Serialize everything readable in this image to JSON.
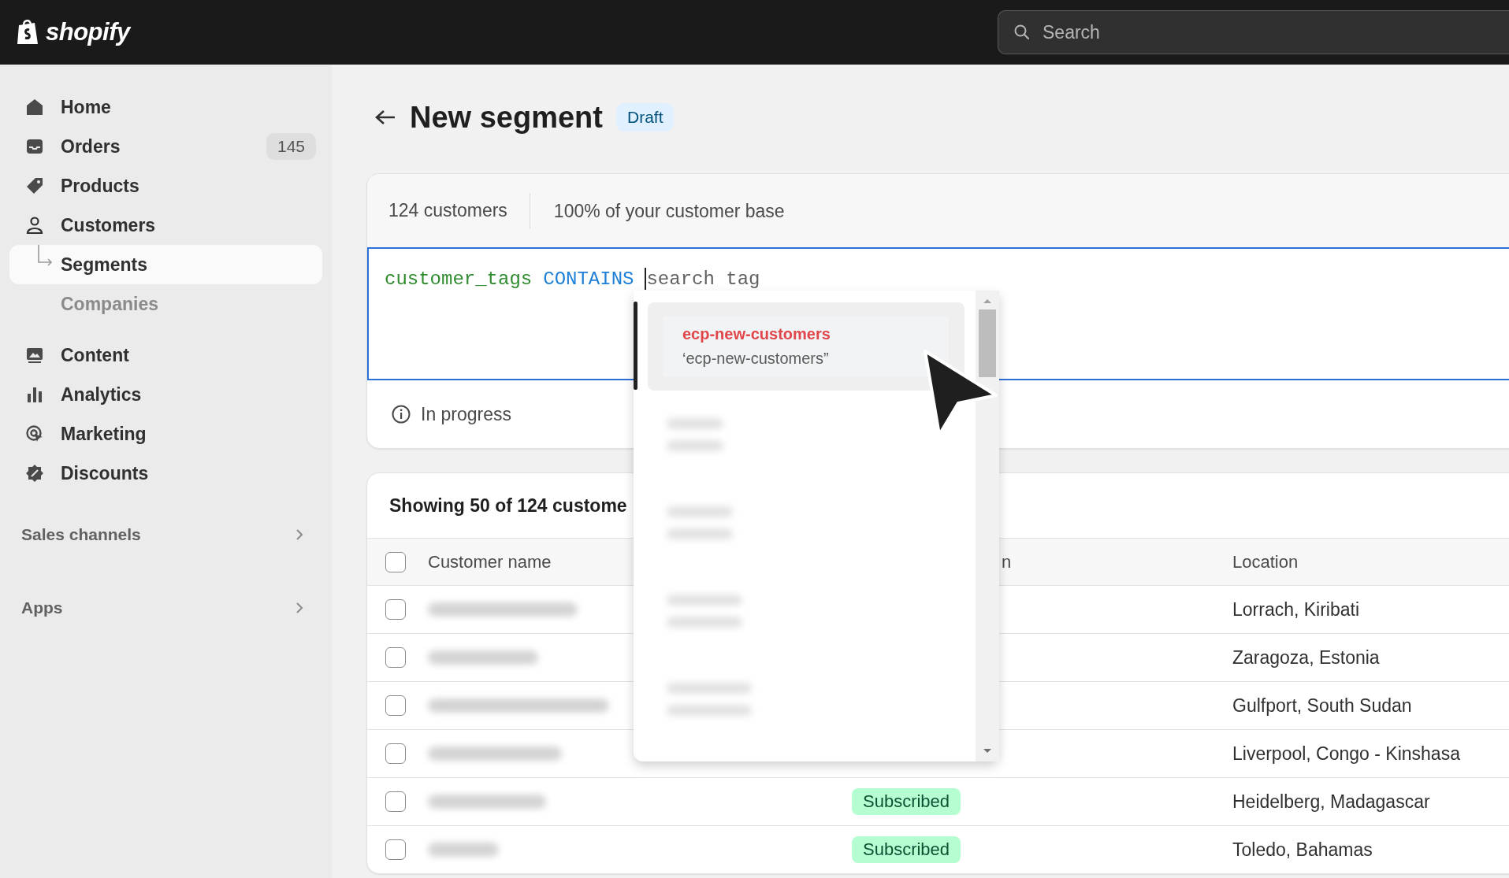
{
  "topbar": {
    "logo_text": "shopify",
    "search": {
      "placeholder": "Search"
    }
  },
  "sidebar": {
    "items": [
      {
        "label": "Home",
        "selected": false
      },
      {
        "label": "Orders",
        "badge": "145",
        "selected": false
      },
      {
        "label": "Products",
        "selected": false
      },
      {
        "label": "Customers",
        "selected": false,
        "children": [
          {
            "label": "Segments",
            "selected": true
          },
          {
            "label": "Companies",
            "selected": false
          }
        ]
      },
      {
        "label": "Content",
        "selected": false
      },
      {
        "label": "Analytics",
        "selected": false
      },
      {
        "label": "Marketing",
        "selected": false
      },
      {
        "label": "Discounts",
        "selected": false
      }
    ],
    "sections": [
      {
        "label": "Sales channels"
      },
      {
        "label": "Apps"
      }
    ]
  },
  "page": {
    "title": "New segment",
    "badge": "Draft"
  },
  "segment_card": {
    "stats": [
      "124 customers",
      "100% of your customer base"
    ],
    "query": [
      {
        "kind": "field",
        "text": "customer_tags"
      },
      {
        "kind": "operator",
        "text": "CONTAINS"
      }
    ],
    "placeholder": "search tag",
    "status": "In progress"
  },
  "autocomplete": {
    "items": [
      {
        "kind": "tag",
        "title": "ecp-new-customers",
        "value": "‘ecp-new-customers”",
        "selected": true
      },
      {
        "kind": "blurred",
        "selected": false
      },
      {
        "kind": "blurred",
        "selected": false
      },
      {
        "kind": "blurred",
        "selected": false
      },
      {
        "kind": "blurred",
        "selected": false
      }
    ]
  },
  "customers_table": {
    "heading": "Showing 50 of 124 custome",
    "header_checked": false,
    "columns": [
      "Customer name",
      "n",
      "Location"
    ],
    "rows": [
      {
        "checked": false,
        "location": "Lorrach, Kiribati"
      },
      {
        "checked": false,
        "location": "Zaragoza, Estonia"
      },
      {
        "checked": false,
        "location": "Gulfport, South Sudan"
      },
      {
        "checked": false,
        "location": "Liverpool, Congo - Kinshasa"
      },
      {
        "checked": false,
        "subscription": "Subscribed",
        "location": "Heidelberg, Madagascar"
      },
      {
        "checked": false,
        "subscription": "Subscribed",
        "location": "Toledo, Bahamas"
      }
    ]
  }
}
